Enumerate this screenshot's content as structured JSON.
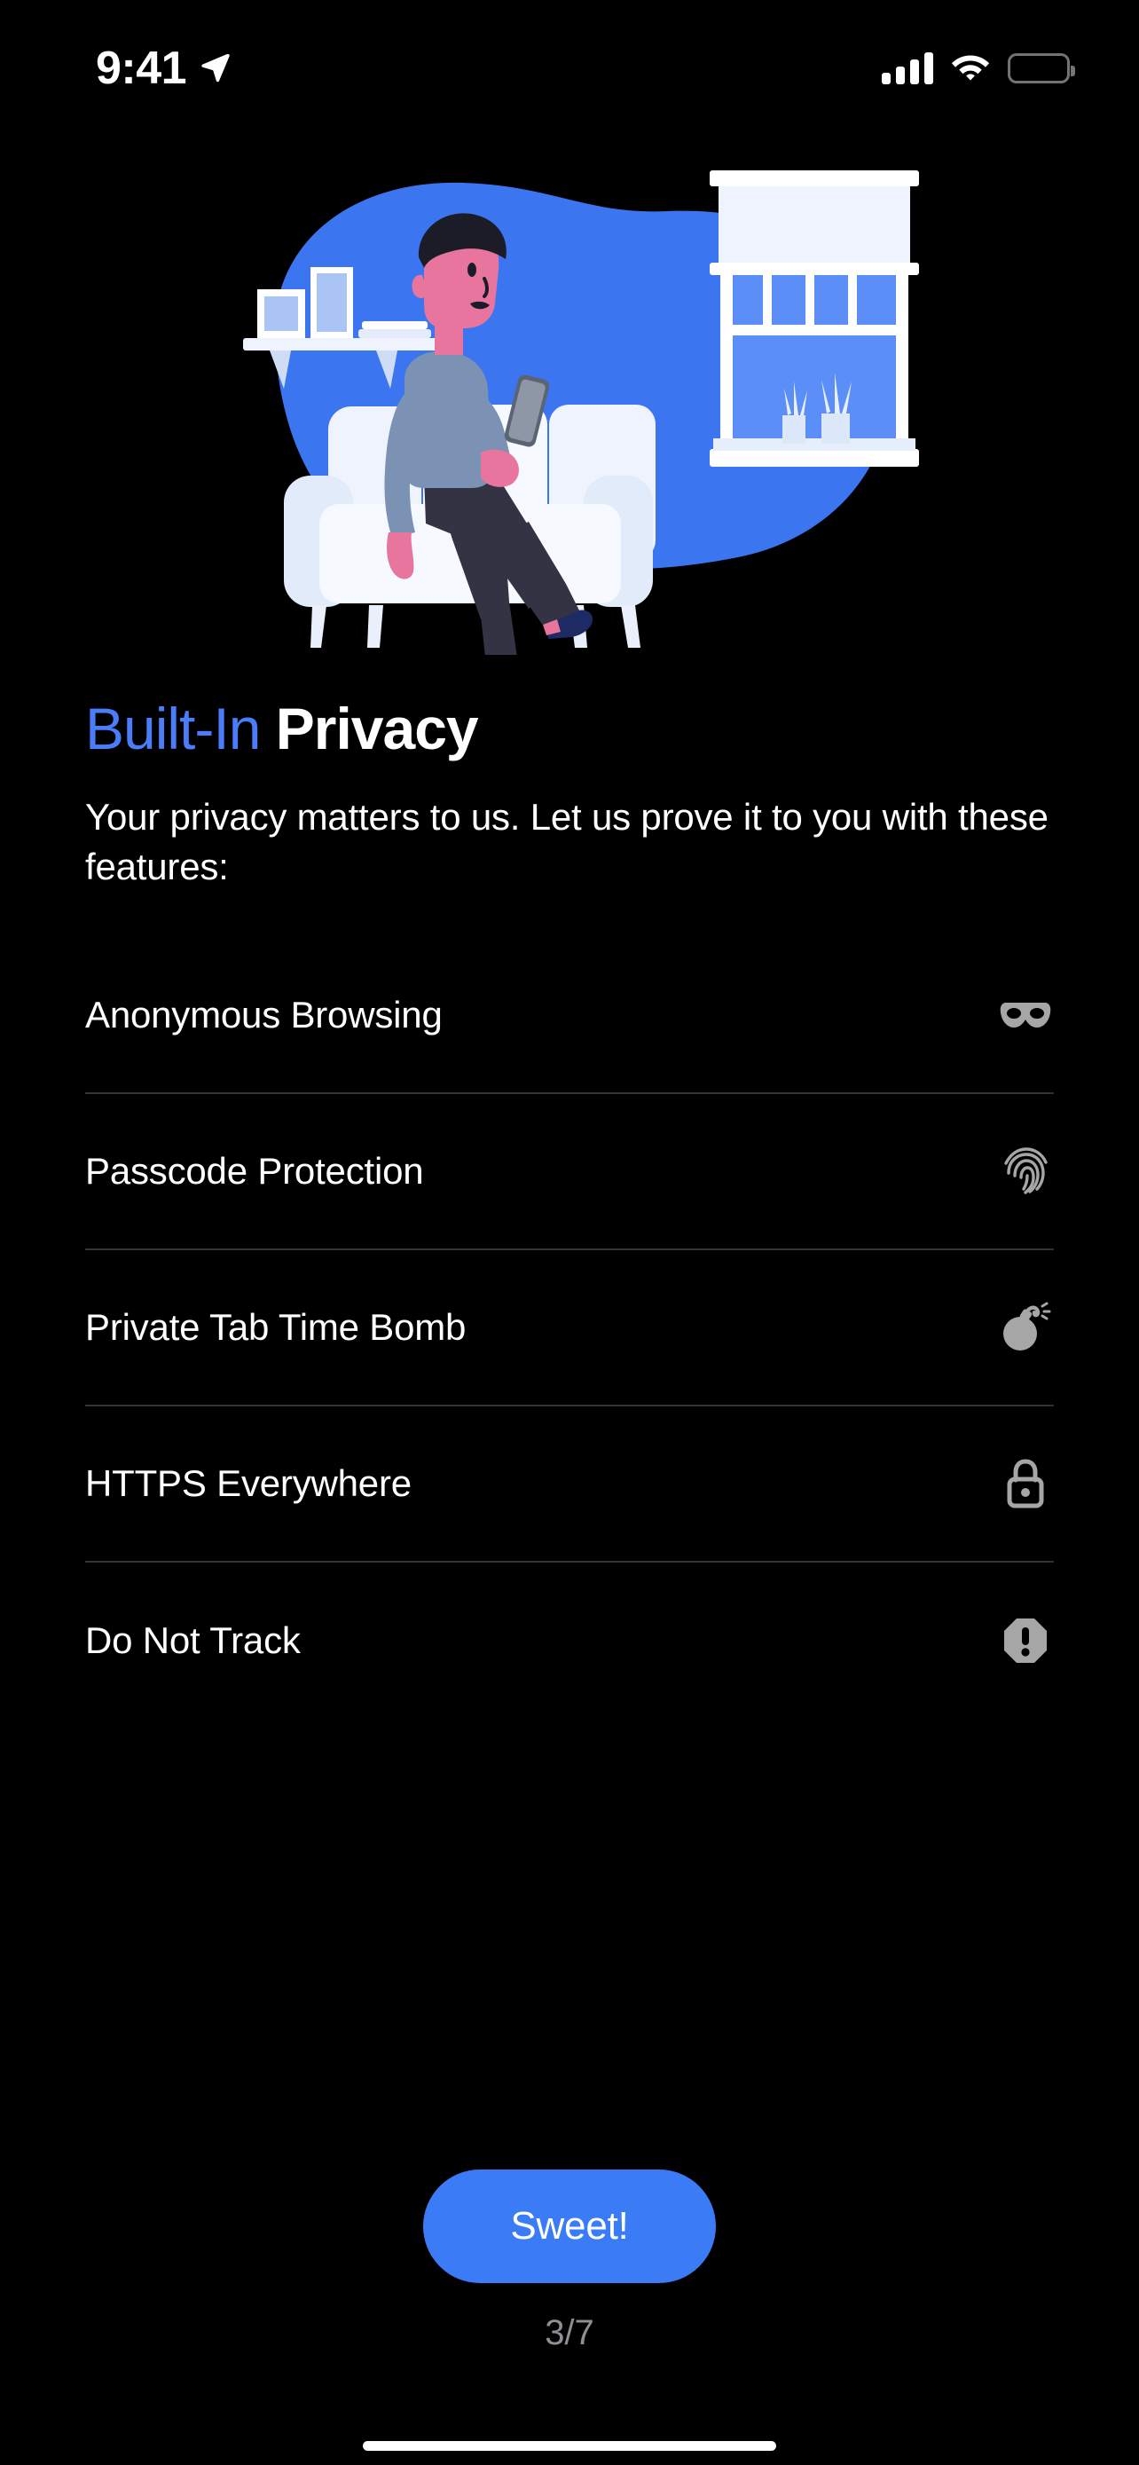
{
  "status_bar": {
    "time": "9:41",
    "location_icon": "location-arrow-icon",
    "cellular_icon": "cellular-signal-icon",
    "wifi_icon": "wifi-icon",
    "battery_icon": "battery-full-icon"
  },
  "illustration": {
    "name": "person-on-sofa-using-phone-illustration",
    "blob_color": "#3b76f0",
    "furniture_color": "#e9f0fc",
    "skin_color": "#e8759e",
    "hair_color": "#1c1c28",
    "shirt_color": "#7b92b5",
    "pants_color": "#333343",
    "shoe_color": "#1d2a63"
  },
  "heading": {
    "light_part": "Built-In",
    "bold_part": "Privacy",
    "light_color": "#4a7dfa",
    "bold_color": "#ffffff"
  },
  "subtitle": "Your privacy matters to us. Let us prove it to you with these features:",
  "features": [
    {
      "label": "Anonymous Browsing",
      "icon": "mask-icon"
    },
    {
      "label": "Passcode Protection",
      "icon": "fingerprint-icon"
    },
    {
      "label": "Private Tab Time Bomb",
      "icon": "bomb-icon"
    },
    {
      "label": "HTTPS Everywhere",
      "icon": "lock-icon"
    },
    {
      "label": "Do Not Track",
      "icon": "stop-exclamation-icon"
    }
  ],
  "footer": {
    "cta_label": "Sweet!",
    "cta_color": "#3b7bf5",
    "page_indicator": "3/7",
    "page_indicator_color": "#8e8e93",
    "home_indicator": "home-indicator-bar"
  }
}
